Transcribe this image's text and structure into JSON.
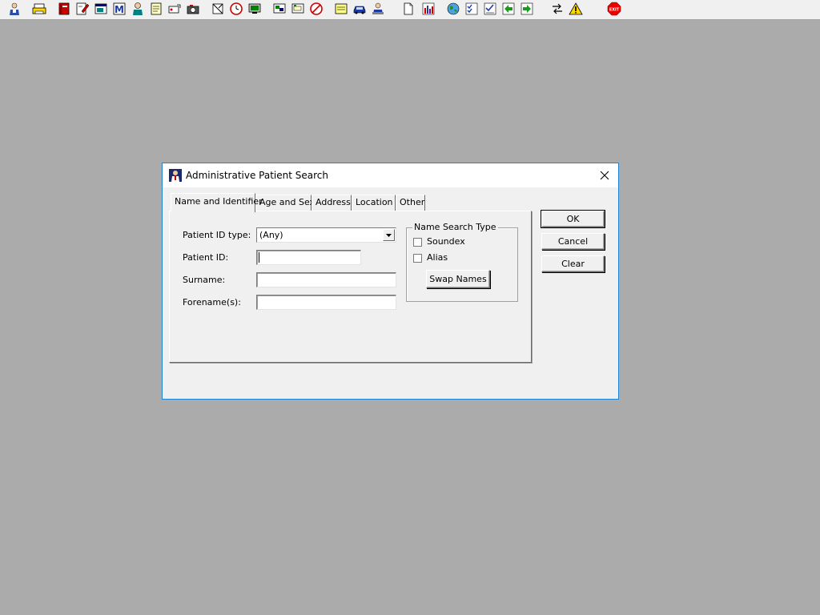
{
  "toolbar": {
    "icons": [
      "user-search",
      "printer",
      "book",
      "edit-document",
      "window-list",
      "letter-m",
      "doctor",
      "notepad",
      "tag",
      "camera",
      "pad-cross",
      "clock",
      "monitor",
      "screen-board",
      "screen-note",
      "stop-sign",
      "note-yellow",
      "car",
      "operator",
      "document",
      "bar-chart",
      "globe",
      "checklist",
      "checklist-2",
      "arrows-green",
      "arrows-green-2",
      "swap-arrows",
      "warning",
      "exit"
    ]
  },
  "dialog": {
    "title": "Administrative Patient Search",
    "tabs": [
      {
        "label": "Name and Identifier",
        "active": true
      },
      {
        "label": "Age and Sex"
      },
      {
        "label": "Address"
      },
      {
        "label": "Location"
      },
      {
        "label": "Other"
      }
    ],
    "fields": {
      "patient_id_type_label": "Patient ID type:",
      "patient_id_type_value": "(Any)",
      "patient_id_label": "Patient ID:",
      "patient_id_value": "",
      "surname_label": "Surname:",
      "surname_value": "",
      "forename_label": "Forename(s):",
      "forename_value": ""
    },
    "name_search": {
      "title": "Name Search Type",
      "soundex_label": "Soundex",
      "soundex_checked": false,
      "alias_label": "Alias",
      "alias_checked": false,
      "swap_names_label": "Swap Names"
    },
    "buttons": {
      "ok": "OK",
      "cancel": "Cancel",
      "clear": "Clear"
    }
  }
}
